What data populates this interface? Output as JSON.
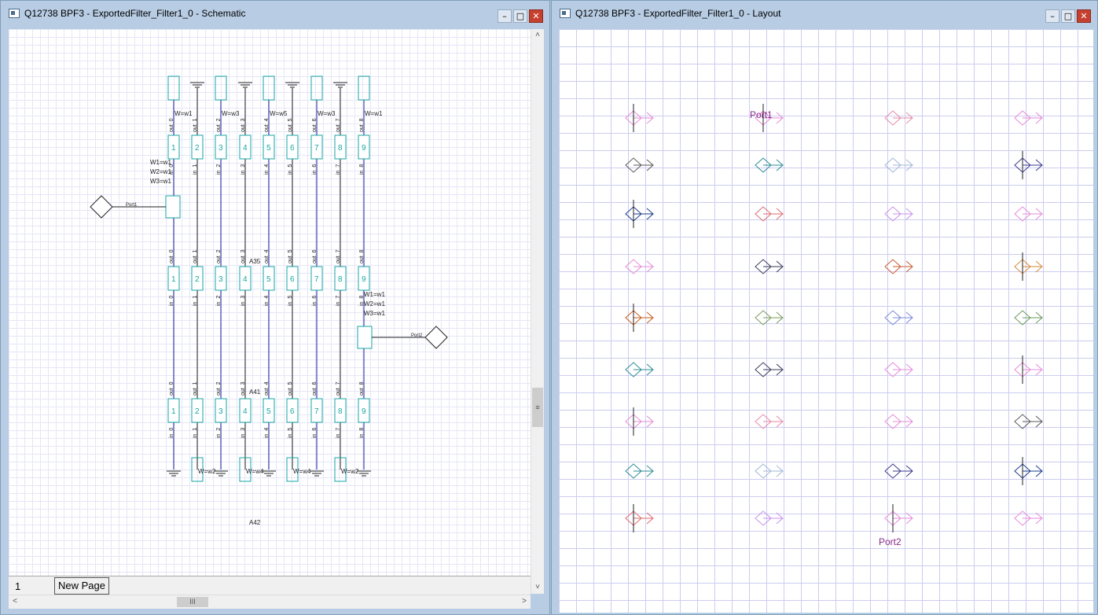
{
  "schematic_window": {
    "title": "Q12738 BPF3 - ExportedFilter_Filter1_0 - Schematic",
    "minimize_label": "–",
    "maximize_label": "□",
    "close_label": "✕",
    "page_number": "1",
    "new_page_label": "New Page",
    "vscroll_up_icon": "˄",
    "vscroll_down_icon": "˅",
    "hscroll_left_icon": "<",
    "hscroll_right_icon": ">",
    "vthumb_grip": "≡",
    "hthumb_grip": "III"
  },
  "layout_window": {
    "title": "Q12738 BPF3 - ExportedFilter_Filter1_0 - Layout",
    "minimize_label": "–",
    "maximize_label": "□",
    "close_label": "✕"
  },
  "schematic": {
    "resonator_numbers": [
      "1",
      "2",
      "3",
      "4",
      "5",
      "6",
      "7",
      "8",
      "9"
    ],
    "top_width_labels": [
      "W=w1",
      "W=w3",
      "W=w5",
      "W=w3",
      "W=w1"
    ],
    "bottom_width_labels": [
      "W=w2",
      "W=w4",
      "W=w4",
      "W=w2"
    ],
    "node_out_labels": [
      "out_0",
      "out_1",
      "out_2",
      "out_3",
      "out_4",
      "out_5",
      "out_6",
      "out_7",
      "out_8"
    ],
    "node_in_labels": [
      "in_0",
      "in_1",
      "in_2",
      "in_3",
      "in_4",
      "in_5",
      "in_6",
      "in_7",
      "in_8"
    ],
    "tee_labels_left": [
      "W1=w1",
      "W2=w1",
      "W3=w1"
    ],
    "tee_labels_right": [
      "W1=w1",
      "W2=w1",
      "W3=w1"
    ],
    "port1_label": "Port1",
    "port2_label": "Port2",
    "section_labels": [
      "A35",
      "A41",
      "A42"
    ]
  },
  "layout": {
    "port1_label": "Port1",
    "port2_label": "Port2",
    "colors": [
      "#e58bd6",
      "#e58bd6",
      "#e68aa6",
      "#e58bd6",
      "#5a5a5a",
      "#2a8c96",
      "#9fb7d4",
      "#3a3a8a",
      "#1a3a8a",
      "#e06a6a",
      "#c792e8",
      "#e58bd6",
      "#e58bd6",
      "#3a3a5a",
      "#c85a32",
      "#d88a3a",
      "#c85a1a",
      "#7a9a5a",
      "#7a8ad8",
      "#6a9a5a",
      "#2a8c96",
      "#3a3a5a",
      "#e58bd6"
    ]
  }
}
